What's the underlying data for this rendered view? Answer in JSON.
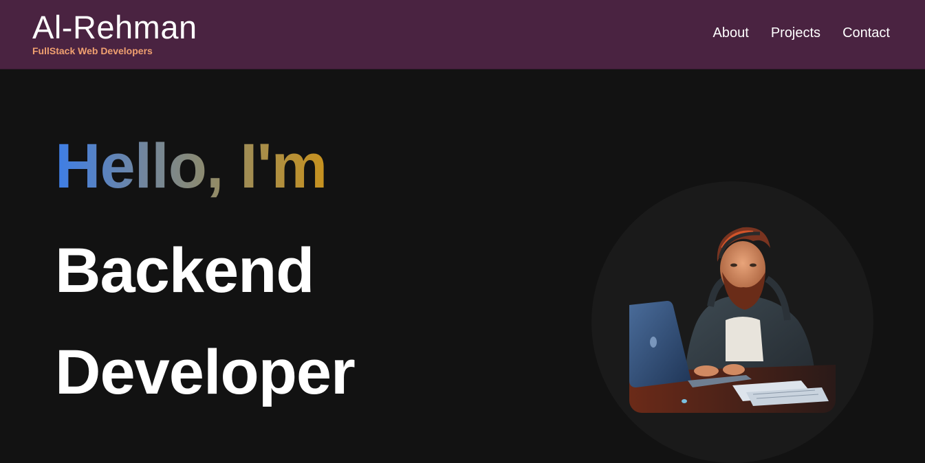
{
  "header": {
    "brand_title": "Al-Rehman",
    "brand_subtitle": "FullStack Web Developers",
    "nav": [
      {
        "label": "About"
      },
      {
        "label": "Projects"
      },
      {
        "label": "Contact"
      }
    ]
  },
  "hero": {
    "greeting": "Hello, I'm",
    "role_line1": "Backend",
    "role_line2": "Developer",
    "avatar_alt": "developer-illustration"
  },
  "colors": {
    "header_bg": "#4a2341",
    "page_bg": "#121212",
    "subtitle": "#f0a070",
    "gradient_start": "#3d7ee8",
    "gradient_end": "#c8921e"
  }
}
